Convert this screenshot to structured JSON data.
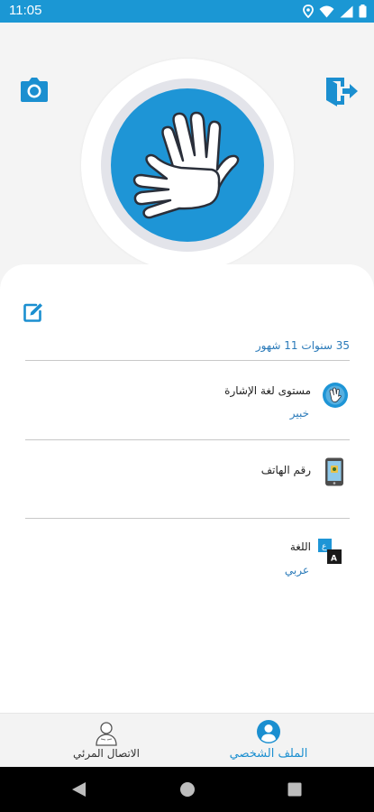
{
  "status_bar": {
    "time": "11:05"
  },
  "profile": {
    "age": "35 سنوات 11 شهور",
    "rows": [
      {
        "title": "مستوى لغة الإشارة",
        "value": "خبير",
        "icon": "sign-language-hands-icon"
      },
      {
        "title": "رقم الهاتف",
        "value": "",
        "icon": "phone-icon"
      },
      {
        "title": "اللغة",
        "value": "عربي",
        "icon": "translate-icon"
      }
    ]
  },
  "bottom_nav": {
    "profile_label": "الملف الشخصي",
    "video_call_label": "الاتصال المرئي"
  },
  "colors": {
    "primary": "#1b97d4",
    "link_blue": "#2a7ab9",
    "avatar_bg": "#1e95d6"
  }
}
